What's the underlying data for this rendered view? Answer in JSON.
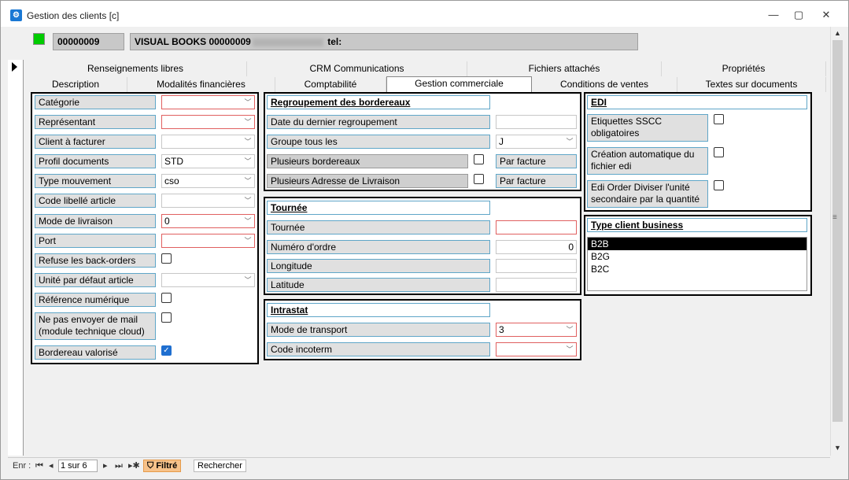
{
  "window": {
    "title": "Gestion des clients [c]",
    "minimize": "—",
    "maximize": "▢",
    "close": "✕"
  },
  "header": {
    "code": "00000009",
    "name_prefix": "VISUAL BOOKS 00000009",
    "name_suffix": " tel:"
  },
  "tabs_row1": [
    "Renseignements libres",
    "CRM Communications",
    "Fichiers attachés",
    "Propriétés"
  ],
  "tabs_row2": [
    "Description",
    "Modalités financières",
    "Comptabilité",
    "Gestion commerciale",
    "Conditions de ventes",
    "Textes sur documents"
  ],
  "left": {
    "categorie": "Catégorie",
    "representant": "Représentant",
    "client_facturer": "Client à facturer",
    "profil_docs": "Profil documents",
    "profil_docs_val": "STD",
    "type_mvt": "Type mouvement",
    "type_mvt_val": "cso",
    "code_lib": "Code libellé article",
    "mode_liv": "Mode de livraison",
    "mode_liv_val": "0",
    "port": "Port",
    "refuse": "Refuse les back-orders",
    "unite": "Unité par défaut article",
    "ref_num": "Référence numérique",
    "ne_pas": "Ne pas envoyer de mail (module technique cloud)",
    "bordereau": "Bordereau valorisé"
  },
  "regroup": {
    "title": "Regroupement des bordereaux",
    "date": "Date du dernier regroupement",
    "groupe": "Groupe tous les",
    "groupe_val": "J",
    "plusieurs_b": "Plusieurs bordereaux",
    "par_facture_1": "Par facture",
    "plusieurs_a": "Plusieurs Adresse de Livraison",
    "par_facture_2": "Par facture"
  },
  "tournee": {
    "title": "Tournée",
    "tournee": "Tournée",
    "numero": "Numéro d'ordre",
    "numero_val": "0",
    "longitude": "Longitude",
    "latitude": "Latitude"
  },
  "intrastat": {
    "title": "Intrastat",
    "mode": "Mode de transport",
    "mode_val": "3",
    "incoterm": "Code incoterm"
  },
  "edi": {
    "title": "EDI",
    "sscc": "Etiquettes SSCC obligatoires",
    "creation": "Création automatique du fichier edi",
    "order": "Edi Order Diviser l'unité secondaire par la quantité"
  },
  "type_client": {
    "title": "Type client business",
    "items": [
      "B2B",
      "B2G",
      "B2C"
    ]
  },
  "status": {
    "enr": "Enr :",
    "pos": "1 sur 6",
    "filtre": "Filtré",
    "rechercher": "Rechercher"
  }
}
